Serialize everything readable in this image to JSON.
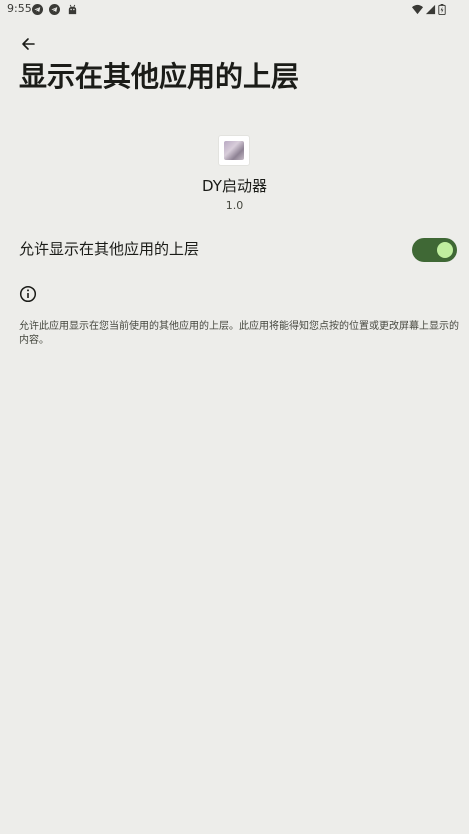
{
  "status_bar": {
    "time": "9:55",
    "left_icons": [
      "telegram-icon",
      "telegram-icon",
      "android-icon"
    ],
    "right_icons": [
      "wifi-icon",
      "cellular-signal-icon",
      "battery-icon"
    ]
  },
  "app_bar": {
    "back_icon": "arrow-back-icon",
    "title": "显示在其他应用的上层"
  },
  "app_info": {
    "name": "DY启动器",
    "version": "1.0"
  },
  "permission": {
    "label": "允许显示在其他应用的上层",
    "enabled": true
  },
  "info": {
    "icon": "info-icon",
    "description": "允许此应用显示在您当前使用的其他应用的上层。此应用将能得知您点按的位置或更改屏幕上显示的内容。"
  },
  "colors": {
    "background": "#ededea",
    "switch_track_on": "#3f6835",
    "switch_thumb_on": "#c0ef9f"
  }
}
